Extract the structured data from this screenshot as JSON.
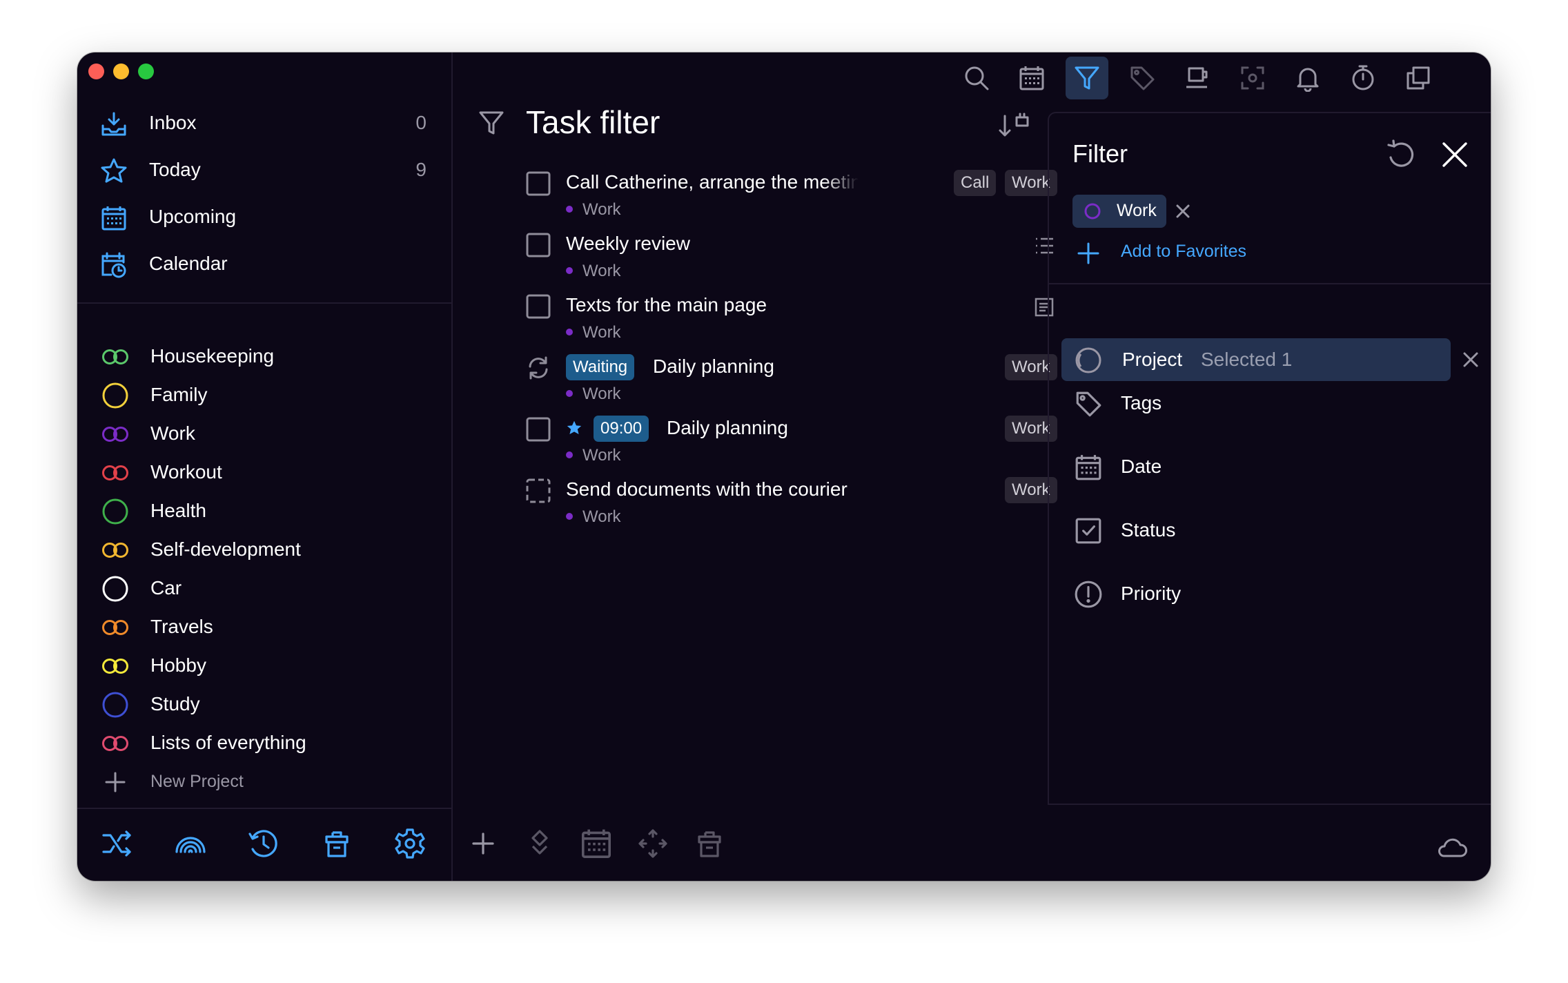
{
  "sidebar": {
    "nav": [
      {
        "label": "Inbox",
        "count": "0",
        "icon": "inbox-icon"
      },
      {
        "label": "Today",
        "count": "9",
        "icon": "star-icon"
      },
      {
        "label": "Upcoming",
        "count": "",
        "icon": "calendar-grid-icon"
      },
      {
        "label": "Calendar",
        "count": "",
        "icon": "calendar-clock-icon"
      }
    ],
    "projects": [
      {
        "label": "Housekeeping",
        "color": "#5bc86b",
        "icon": "double-ring-icon"
      },
      {
        "label": "Family",
        "color": "#f2d03b",
        "icon": "ring-icon"
      },
      {
        "label": "Work",
        "color": "#7b2cc7",
        "icon": "double-ring-icon"
      },
      {
        "label": "Workout",
        "color": "#e2414a",
        "icon": "double-ring-icon"
      },
      {
        "label": "Health",
        "color": "#3fb04b",
        "icon": "ring-icon"
      },
      {
        "label": "Self-development",
        "color": "#f1b630",
        "icon": "double-ring-icon"
      },
      {
        "label": "Car",
        "color": "#ffffff",
        "icon": "ring-icon"
      },
      {
        "label": "Travels",
        "color": "#f08a2a",
        "icon": "double-ring-icon"
      },
      {
        "label": "Hobby",
        "color": "#f3e83a",
        "icon": "double-ring-icon"
      },
      {
        "label": "Study",
        "color": "#3e4fd3",
        "icon": "ring-icon"
      },
      {
        "label": "Lists of everything",
        "color": "#e04b6f",
        "icon": "double-ring-icon"
      }
    ],
    "new_project_label": "New Project"
  },
  "main": {
    "title": "Task filter",
    "tasks": [
      {
        "title": "Call Catherine, arrange the meeting",
        "project": "Work",
        "chips": [
          "Call",
          "Work"
        ]
      },
      {
        "title": "Weekly review",
        "project": "Work",
        "chips": []
      },
      {
        "title": "Texts for the main page",
        "project": "Work",
        "chips": []
      },
      {
        "title": "Daily planning",
        "project": "Work",
        "status_chip": "Waiting",
        "chips": [
          "Work"
        ]
      },
      {
        "title": "Daily planning",
        "project": "Work",
        "time_chip": "09:00",
        "chips": [
          "Work"
        ]
      },
      {
        "title": "Send documents with the courier",
        "project": "Work",
        "chips": [
          "Work"
        ]
      }
    ]
  },
  "panel": {
    "title": "Filter",
    "active_filter_chip": "Work",
    "add_favorites_label": "Add to Favorites",
    "project_row": {
      "label": "Project",
      "selected_text": "Selected 1"
    },
    "rows": [
      {
        "label": "Tags",
        "icon": "tag-icon"
      },
      {
        "label": "Date",
        "icon": "calendar-icon"
      },
      {
        "label": "Status",
        "icon": "status-check-icon"
      },
      {
        "label": "Priority",
        "icon": "priority-icon"
      }
    ]
  },
  "colors": {
    "background": "#0c0717",
    "accent_blue": "#45a8ff",
    "selected_row": "#243250",
    "work_purple": "#7b2cc7"
  }
}
